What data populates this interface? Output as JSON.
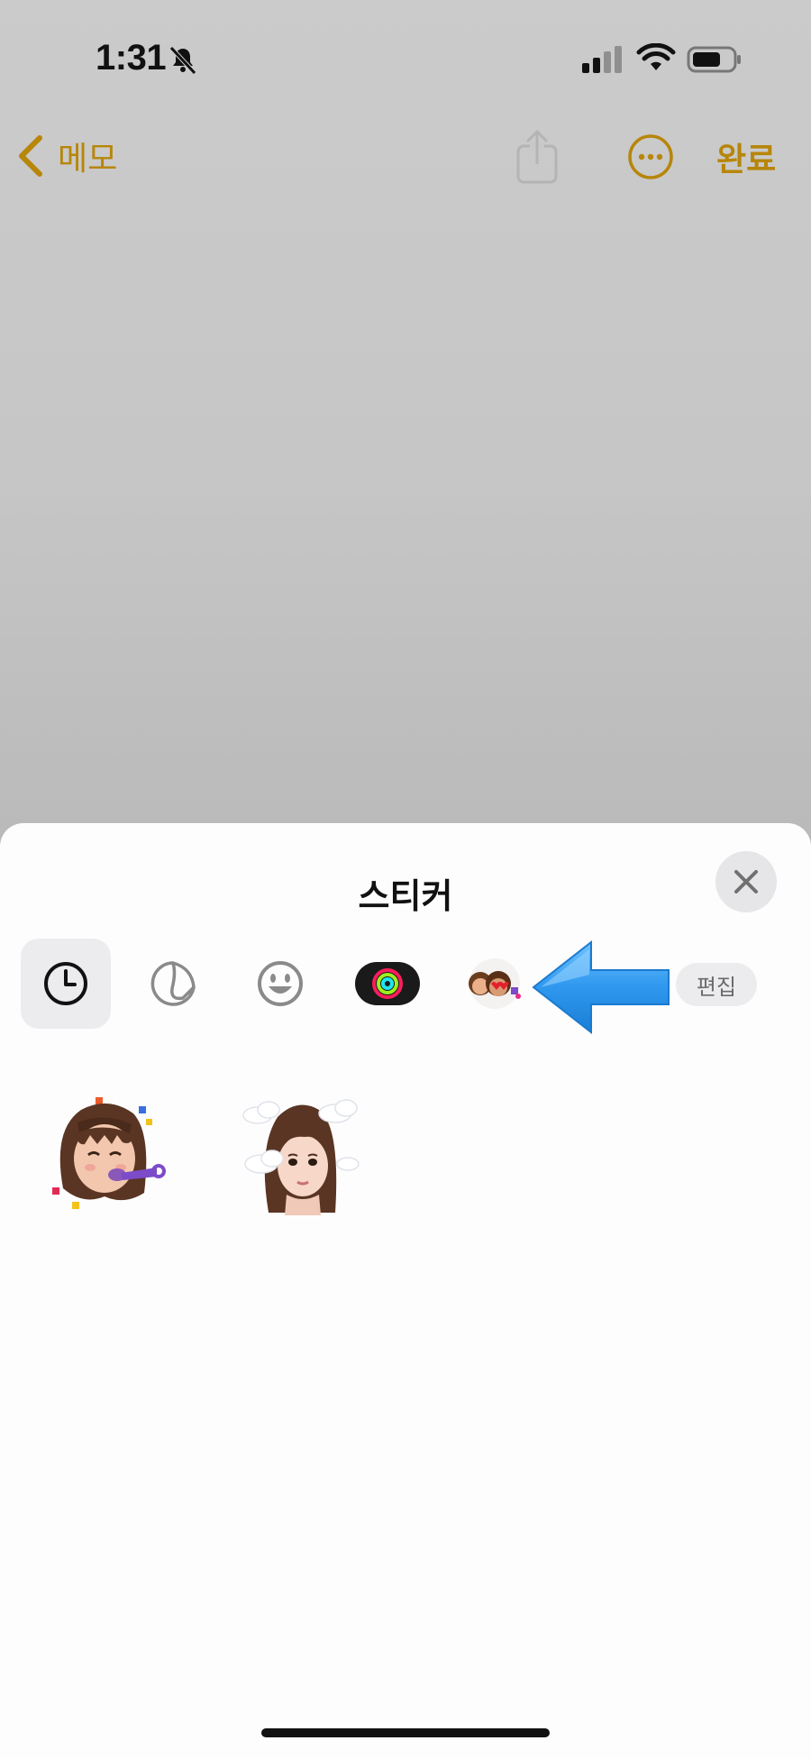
{
  "status_bar": {
    "time": "1:31",
    "icons": [
      "bell-slash-icon",
      "cellular-signal-icon",
      "wifi-icon",
      "battery-icon"
    ]
  },
  "nav": {
    "back_label": "메모",
    "done_label": "완료",
    "icons": [
      "chevron-left-icon",
      "share-icon",
      "more-icon"
    ],
    "accent_color": "#b7860a"
  },
  "sheet": {
    "title": "스티커",
    "edit_label": "편집",
    "categories": [
      {
        "name": "recent",
        "icon": "clock-icon",
        "selected": true
      },
      {
        "name": "my-stickers",
        "icon": "sticker-peel-icon",
        "selected": false
      },
      {
        "name": "emoji",
        "icon": "smiley-icon",
        "selected": false
      },
      {
        "name": "activity",
        "icon": "activity-rings-icon",
        "selected": false
      },
      {
        "name": "memoji",
        "icon": "memoji-icon",
        "selected": false
      },
      {
        "name": "app-sticker",
        "icon": "app-sticker-icon",
        "selected": false
      }
    ],
    "stickers": [
      {
        "name": "memoji-party-horn-sticker"
      },
      {
        "name": "memoji-clouds-sticker"
      }
    ],
    "annotation_color": "#3aa3f0"
  }
}
